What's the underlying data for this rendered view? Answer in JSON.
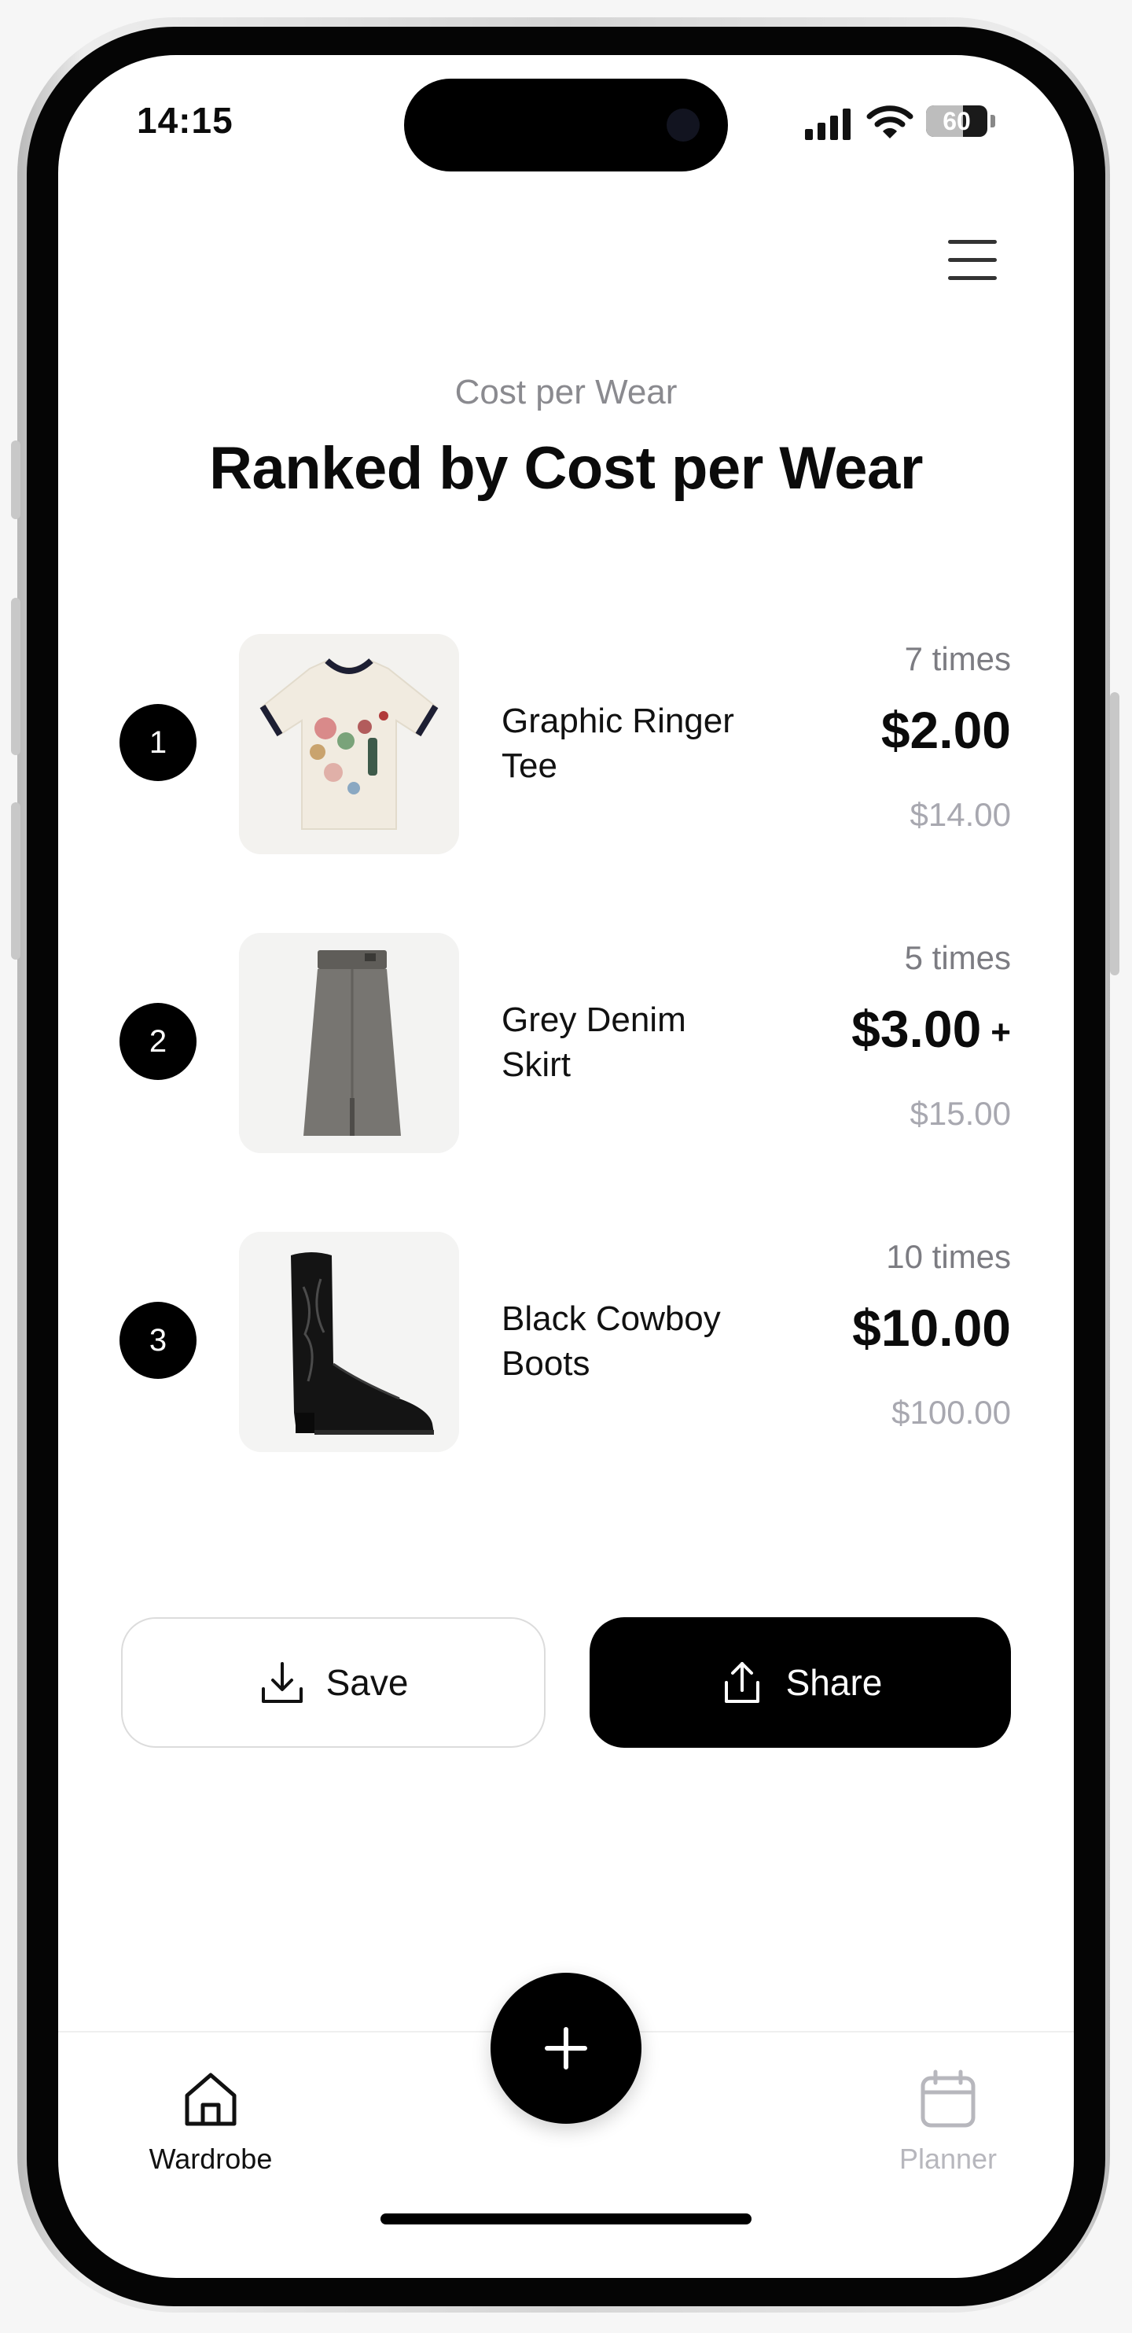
{
  "status_bar": {
    "time": "14:15",
    "battery": "60",
    "battery_level": 0.6
  },
  "header": {
    "subtitle": "Cost per Wear",
    "title": "Ranked by Cost per Wear"
  },
  "items": [
    {
      "rank": "1",
      "name": "Graphic Ringer Tee",
      "wears": "7 times",
      "cost_per_wear": "$2.00",
      "price": "$14.00",
      "image": "graphic-ringer-tee"
    },
    {
      "rank": "2",
      "name": "Grey Denim Skirt",
      "wears": "5 times",
      "cost_per_wear": "$3.00",
      "cost_per_wear_suffix": "+",
      "price": "$15.00",
      "image": "grey-denim-skirt"
    },
    {
      "rank": "3",
      "name": "Black Cowboy Boots",
      "wears": "10 times",
      "cost_per_wear": "$10.00",
      "price": "$100.00",
      "image": "black-cowboy-boots"
    }
  ],
  "actions": {
    "save_label": "Save",
    "share_label": "Share"
  },
  "nav": {
    "wardrobe_label": "Wardrobe",
    "planner_label": "Planner",
    "active": "Wardrobe"
  },
  "icons": {
    "menu": "hamburger-icon",
    "save": "download-icon",
    "share": "share-icon",
    "wardrobe": "home-icon",
    "planner": "calendar-icon",
    "fab": "plus-icon"
  },
  "colors": {
    "accent": "#000000",
    "muted_text": "#8a8a8f",
    "price_text": "#a8a8b0",
    "inactive_nav": "#b7b7bd"
  }
}
